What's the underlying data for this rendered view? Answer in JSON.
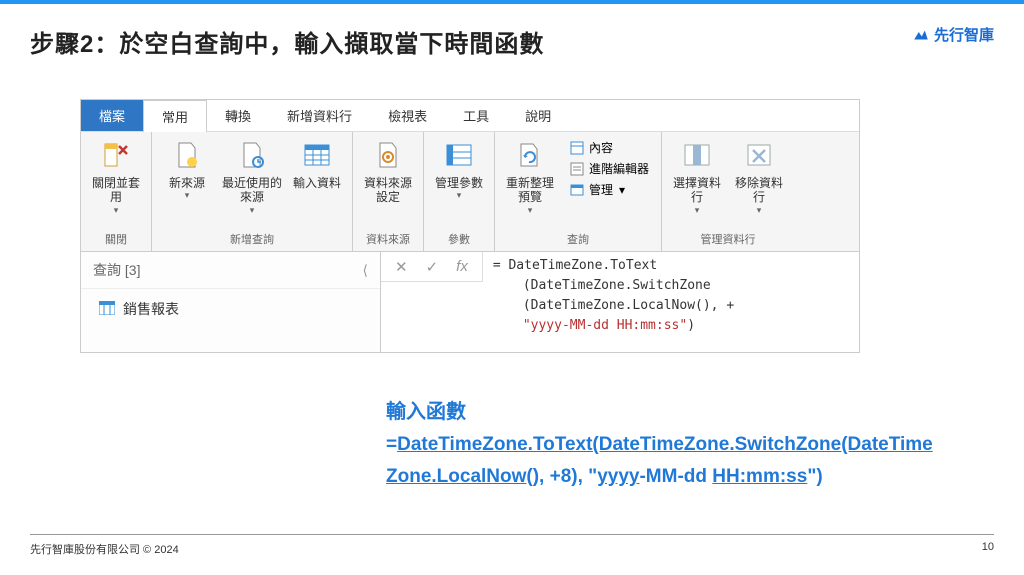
{
  "slide": {
    "title": "步驟2：於空白查詢中，輸入擷取當下時間函數",
    "logo_text": "先行智庫"
  },
  "ribbon": {
    "tabs": [
      "檔案",
      "常用",
      "轉換",
      "新增資料行",
      "檢視表",
      "工具",
      "說明"
    ],
    "groups": {
      "close": {
        "label": "關閉",
        "btn_close_apply": "關閉並套用"
      },
      "new_query": {
        "label": "新增查詢",
        "btn_new_source": "新來源",
        "btn_recent_sources": "最近使用的來源",
        "btn_enter_data": "輸入資料"
      },
      "data_source": {
        "label": "資料來源",
        "btn_settings": "資料來源設定"
      },
      "params": {
        "label": "參數",
        "btn_manage_params": "管理參數"
      },
      "query": {
        "label": "查詢",
        "btn_refresh_preview": "重新整理預覽",
        "item_content": "內容",
        "item_adv_editor": "進階編輯器",
        "item_manage": "管理"
      },
      "manage_cols": {
        "label": "管理資料行",
        "btn_select_cols": "選擇資料行",
        "btn_remove_cols": "移除資料行"
      }
    }
  },
  "queries": {
    "header": "查詢 [3]",
    "item1": "銷售報表"
  },
  "formula": {
    "line1": "= DateTimeZone.ToText",
    "line2_a": "(DateTimeZone.SwitchZone",
    "line2_b": "(DateTimeZone.LocalNow(), +",
    "line3_str": "\"yyyy-MM-dd HH:mm:ss\"",
    "line3_end": ")"
  },
  "annotation": {
    "heading": "輸入函數",
    "line1_a": "=",
    "line1_b": "DateTimeZone.ToText(DateTimeZone.SwitchZone(DateTime",
    "line2_a": "Zone.LocalNow",
    "line2_b": "(), +8), \"",
    "line2_c": "yyyy",
    "line2_d": "-MM-dd ",
    "line2_e": "HH:mm:ss",
    "line2_f": "\")"
  },
  "footer": {
    "copyright": "先行智庫股份有限公司 © 2024",
    "page": "10"
  }
}
